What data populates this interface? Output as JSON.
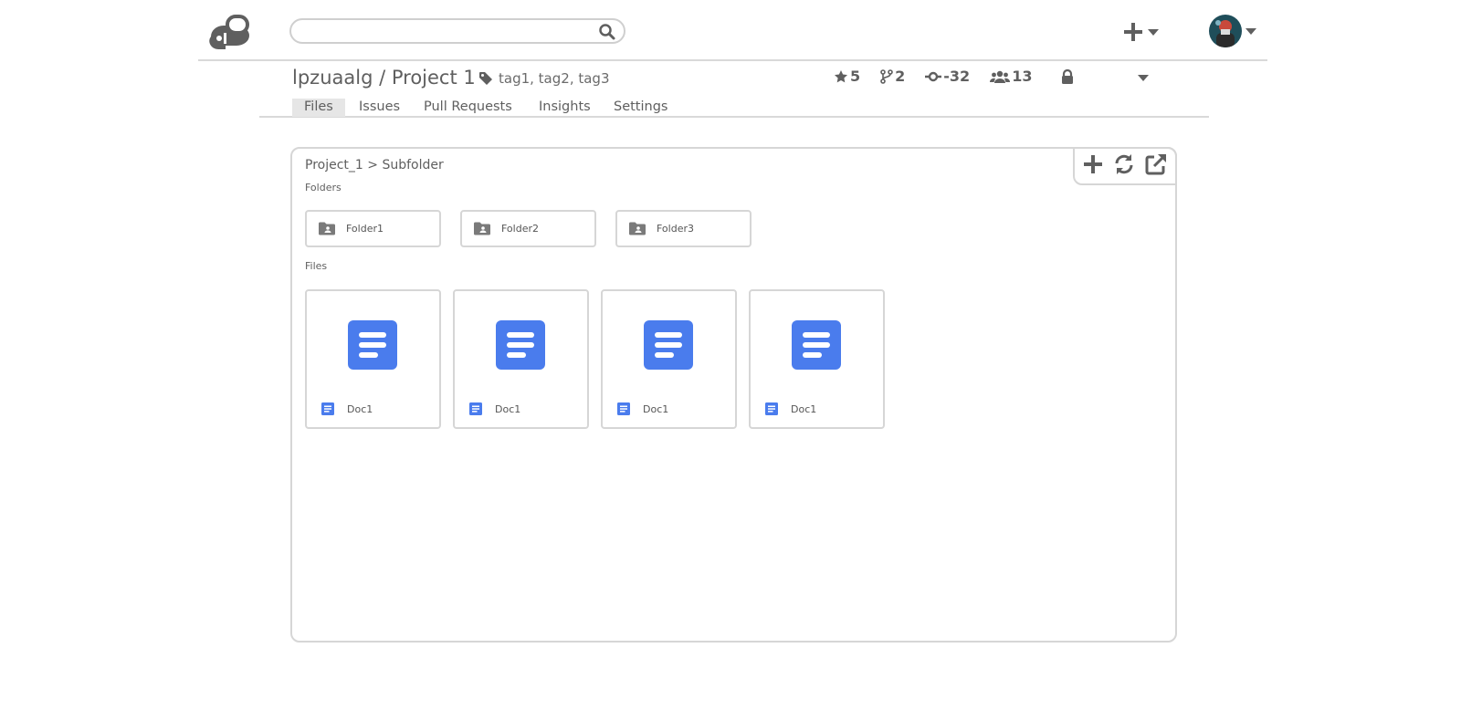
{
  "header": {
    "search_placeholder": ""
  },
  "project": {
    "owner": "lpzuaalg",
    "separator": "/",
    "name": "Project 1",
    "tags": "tag1, tag2, tag3",
    "stats": {
      "stars": "5",
      "forks": "2",
      "commits": "-32",
      "members": "13"
    }
  },
  "tabs": [
    {
      "label": "Files",
      "active": true
    },
    {
      "label": "Issues"
    },
    {
      "label": "Pull Requests"
    },
    {
      "label": "Insights"
    },
    {
      "label": "Settings"
    }
  ],
  "browser": {
    "breadcrumb": "Project_1 > Subfolder",
    "folders_label": "Folders",
    "files_label": "Files",
    "folders": [
      {
        "name": "Folder1"
      },
      {
        "name": "Folder2"
      },
      {
        "name": "Folder3"
      }
    ],
    "files": [
      {
        "name": "Doc1"
      },
      {
        "name": "Doc1"
      },
      {
        "name": "Doc1"
      },
      {
        "name": "Doc1"
      }
    ]
  },
  "colors": {
    "doc_blue": "#4a7ced",
    "icon_gray": "#5f5f5f",
    "border_gray": "#d6d6d6"
  },
  "icons": {
    "logo": "app-logo",
    "search": "search-icon",
    "add": "plus-icon",
    "refresh": "refresh-icon",
    "open": "external-link-icon",
    "lock": "lock-icon"
  }
}
